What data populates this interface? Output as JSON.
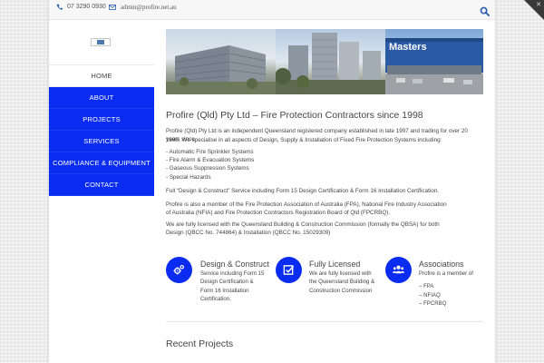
{
  "topbar": {
    "phone": "07 3290 0930",
    "email": "admin@profire.net.au",
    "search_icon": "search-icon"
  },
  "nav": {
    "items": [
      "HOME",
      "ABOUT",
      "PROJECTS",
      "SERVICES",
      "COMPLIANCE & EQUIPMENT",
      "CONTACT"
    ],
    "active": "HOME"
  },
  "banner": {
    "store_sign": "Masters"
  },
  "main": {
    "title": "Profire (Qld) Pty Ltd – Fire Protection Contractors since 1998",
    "intro_line1": "Profire (Qld) Pty Ltd is an independent Queensland registered company established in late 1997 and trading for over 20 years since",
    "intro_line2": "1998. We specialise in all aspects of Design, Supply & Installation of Fixed Fire Protection Systems including:",
    "systems": [
      "- Automatic Fire Sprinkler Systems",
      "- Fire Alarm & Evacuation Systems",
      "- Gaseous Suppression Systems",
      "- Special Hazards"
    ],
    "design_construct": "Full “Design & Construct” Service including Form 15 Design Certification & Form 16 Installation Certification.",
    "member_line1": "Profire is also a member of the Fire Protection Association of Australia (FPA), National Fire Industry Association",
    "member_line2": "of Australia (NFIA) and Fire Protection Contractors Registration Board of Qld (FPCRBQ).",
    "licensed_line1": "We are fully licensed with the Queensland Building & Construction Commission (formally the QBSA) for both",
    "licensed_line2": "Design (QBCC No. 744864) & Installation (QBCC No. 15029309)"
  },
  "features": [
    {
      "icon": "gears-icon",
      "title": "Design & Construct",
      "lines": [
        "Service including Form 15",
        "Design Certification &",
        "Form 16 Installation",
        "Certification."
      ]
    },
    {
      "icon": "checkbox-icon",
      "title": "Fully Licensed",
      "lines": [
        "We are fully licensed with",
        "the Queensland Building &",
        "Construction Commission"
      ]
    },
    {
      "icon": "users-icon",
      "title": "Associations",
      "lines": [
        "Profire is a member of",
        "",
        "– FPA",
        "– NFIAQ",
        "– FPCRBQ"
      ]
    }
  ],
  "recent": {
    "heading": "Recent Projects"
  },
  "colors": {
    "accent": "#0a2cf0",
    "text": "#444444",
    "search": "#2a5db0"
  }
}
